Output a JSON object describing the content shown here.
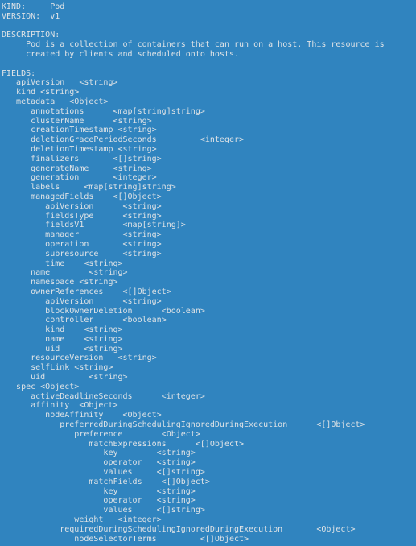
{
  "terminal": {
    "app": "kubectl explain pod",
    "background_color": "#3084bf",
    "text_color": "#dfe3e6",
    "font": "monospace",
    "header": {
      "kind_label": "KIND:",
      "kind_value": "Pod",
      "version_label": "VERSION:",
      "version_value": "v1",
      "description_label": "DESCRIPTION:",
      "description_lines": [
        "Pod is a collection of containers that can run on a host. This resource is",
        "created by clients and scheduled onto hosts."
      ],
      "fields_label": "FIELDS:"
    },
    "lines": [
      "KIND:     Pod",
      "VERSION:  v1",
      "",
      "DESCRIPTION:",
      "     Pod is a collection of containers that can run on a host. This resource is",
      "     created by clients and scheduled onto hosts.",
      "",
      "FIELDS:",
      "   apiVersion\t<string>",
      "   kind\t<string>",
      "   metadata\t<Object>",
      "      annotations\t<map[string]string>",
      "      clusterName\t<string>",
      "      creationTimestamp\t<string>",
      "      deletionGracePeriodSeconds\t<integer>",
      "      deletionTimestamp\t<string>",
      "      finalizers\t<[]string>",
      "      generateName\t<string>",
      "      generation\t<integer>",
      "      labels\t<map[string]string>",
      "      managedFields\t<[]Object>",
      "         apiVersion\t<string>",
      "         fieldsType\t<string>",
      "         fieldsV1\t<map[string]>",
      "         manager\t<string>",
      "         operation\t<string>",
      "         subresource\t<string>",
      "         time\t<string>",
      "      name\t<string>",
      "      namespace\t<string>",
      "      ownerReferences\t<[]Object>",
      "         apiVersion\t<string>",
      "         blockOwnerDeletion\t<boolean>",
      "         controller\t<boolean>",
      "         kind\t<string>",
      "         name\t<string>",
      "         uid\t<string>",
      "      resourceVersion\t<string>",
      "      selfLink\t<string>",
      "      uid\t<string>",
      "   spec\t<Object>",
      "      activeDeadlineSeconds\t<integer>",
      "      affinity\t<Object>",
      "         nodeAffinity\t<Object>",
      "            preferredDuringSchedulingIgnoredDuringExecution\t<[]Object>",
      "               preference\t<Object>",
      "                  matchExpressions\t<[]Object>",
      "                     key\t<string>",
      "                     operator\t<string>",
      "                     values\t<[]string>",
      "                  matchFields\t<[]Object>",
      "                     key\t<string>",
      "                     operator\t<string>",
      "                     values\t<[]string>",
      "               weight\t<integer>",
      "            requiredDuringSchedulingIgnoredDuringExecution\t<Object>",
      "               nodeSelectorTerms\t<[]Object>"
    ],
    "rendered_lines": [
      {
        "indent": 0,
        "name": "KIND:",
        "gap": 5,
        "type": "Pod"
      },
      {
        "indent": 0,
        "name": "VERSION:",
        "gap": 2,
        "type": "v1"
      },
      {
        "blank": true
      },
      {
        "indent": 0,
        "name": "DESCRIPTION:",
        "gap": 0,
        "type": ""
      },
      {
        "indent": 5,
        "name": "Pod is a collection of containers that can run on a host. This resource is",
        "gap": 0,
        "type": ""
      },
      {
        "indent": 5,
        "name": "created by clients and scheduled onto hosts.",
        "gap": 0,
        "type": ""
      },
      {
        "blank": true
      },
      {
        "indent": 0,
        "name": "FIELDS:",
        "gap": 0,
        "type": ""
      },
      {
        "indent": 3,
        "name": "apiVersion",
        "gap": 3,
        "type": "<string>"
      },
      {
        "indent": 3,
        "name": "kind",
        "gap": 1,
        "type": "<string>"
      },
      {
        "indent": 3,
        "name": "metadata",
        "gap": 3,
        "type": "<Object>"
      },
      {
        "indent": 6,
        "name": "annotations",
        "gap": 6,
        "type": "<map[string]string>"
      },
      {
        "indent": 6,
        "name": "clusterName",
        "gap": 6,
        "type": "<string>"
      },
      {
        "indent": 6,
        "name": "creationTimestamp",
        "gap": 1,
        "type": "<string>"
      },
      {
        "indent": 6,
        "name": "deletionGracePeriodSeconds",
        "gap": 9,
        "type": "<integer>"
      },
      {
        "indent": 6,
        "name": "deletionTimestamp",
        "gap": 1,
        "type": "<string>"
      },
      {
        "indent": 6,
        "name": "finalizers",
        "gap": 7,
        "type": "<[]string>"
      },
      {
        "indent": 6,
        "name": "generateName",
        "gap": 5,
        "type": "<string>"
      },
      {
        "indent": 6,
        "name": "generation",
        "gap": 7,
        "type": "<integer>"
      },
      {
        "indent": 6,
        "name": "labels",
        "gap": 5,
        "type": "<map[string]string>"
      },
      {
        "indent": 6,
        "name": "managedFields",
        "gap": 4,
        "type": "<[]Object>"
      },
      {
        "indent": 9,
        "name": "apiVersion",
        "gap": 6,
        "type": "<string>"
      },
      {
        "indent": 9,
        "name": "fieldsType",
        "gap": 6,
        "type": "<string>"
      },
      {
        "indent": 9,
        "name": "fieldsV1",
        "gap": 8,
        "type": "<map[string]>"
      },
      {
        "indent": 9,
        "name": "manager",
        "gap": 9,
        "type": "<string>"
      },
      {
        "indent": 9,
        "name": "operation",
        "gap": 7,
        "type": "<string>"
      },
      {
        "indent": 9,
        "name": "subresource",
        "gap": 5,
        "type": "<string>"
      },
      {
        "indent": 9,
        "name": "time",
        "gap": 4,
        "type": "<string>"
      },
      {
        "indent": 6,
        "name": "name",
        "gap": 8,
        "type": "<string>"
      },
      {
        "indent": 6,
        "name": "namespace",
        "gap": 1,
        "type": "<string>"
      },
      {
        "indent": 6,
        "name": "ownerReferences",
        "gap": 4,
        "type": "<[]Object>"
      },
      {
        "indent": 9,
        "name": "apiVersion",
        "gap": 6,
        "type": "<string>"
      },
      {
        "indent": 9,
        "name": "blockOwnerDeletion",
        "gap": 6,
        "type": "<boolean>"
      },
      {
        "indent": 9,
        "name": "controller",
        "gap": 6,
        "type": "<boolean>"
      },
      {
        "indent": 9,
        "name": "kind",
        "gap": 4,
        "type": "<string>"
      },
      {
        "indent": 9,
        "name": "name",
        "gap": 4,
        "type": "<string>"
      },
      {
        "indent": 9,
        "name": "uid",
        "gap": 5,
        "type": "<string>"
      },
      {
        "indent": 6,
        "name": "resourceVersion",
        "gap": 3,
        "type": "<string>"
      },
      {
        "indent": 6,
        "name": "selfLink",
        "gap": 1,
        "type": "<string>"
      },
      {
        "indent": 6,
        "name": "uid",
        "gap": 9,
        "type": "<string>"
      },
      {
        "indent": 3,
        "name": "spec",
        "gap": 1,
        "type": "<Object>"
      },
      {
        "indent": 6,
        "name": "activeDeadlineSeconds",
        "gap": 6,
        "type": "<integer>"
      },
      {
        "indent": 6,
        "name": "affinity",
        "gap": 2,
        "type": "<Object>"
      },
      {
        "indent": 9,
        "name": "nodeAffinity",
        "gap": 4,
        "type": "<Object>"
      },
      {
        "indent": 12,
        "name": "preferredDuringSchedulingIgnoredDuringExecution",
        "gap": 6,
        "type": "<[]Object>"
      },
      {
        "indent": 15,
        "name": "preference",
        "gap": 8,
        "type": "<Object>"
      },
      {
        "indent": 18,
        "name": "matchExpressions",
        "gap": 6,
        "type": "<[]Object>"
      },
      {
        "indent": 21,
        "name": "key",
        "gap": 8,
        "type": "<string>"
      },
      {
        "indent": 21,
        "name": "operator",
        "gap": 3,
        "type": "<string>"
      },
      {
        "indent": 21,
        "name": "values",
        "gap": 5,
        "type": "<[]string>"
      },
      {
        "indent": 18,
        "name": "matchFields",
        "gap": 4,
        "type": "<[]Object>"
      },
      {
        "indent": 21,
        "name": "key",
        "gap": 8,
        "type": "<string>"
      },
      {
        "indent": 21,
        "name": "operator",
        "gap": 3,
        "type": "<string>"
      },
      {
        "indent": 21,
        "name": "values",
        "gap": 5,
        "type": "<[]string>"
      },
      {
        "indent": 15,
        "name": "weight",
        "gap": 3,
        "type": "<integer>"
      },
      {
        "indent": 12,
        "name": "requiredDuringSchedulingIgnoredDuringExecution",
        "gap": 7,
        "type": "<Object>"
      },
      {
        "indent": 15,
        "name": "nodeSelectorTerms",
        "gap": 9,
        "type": "<[]Object>"
      }
    ]
  }
}
